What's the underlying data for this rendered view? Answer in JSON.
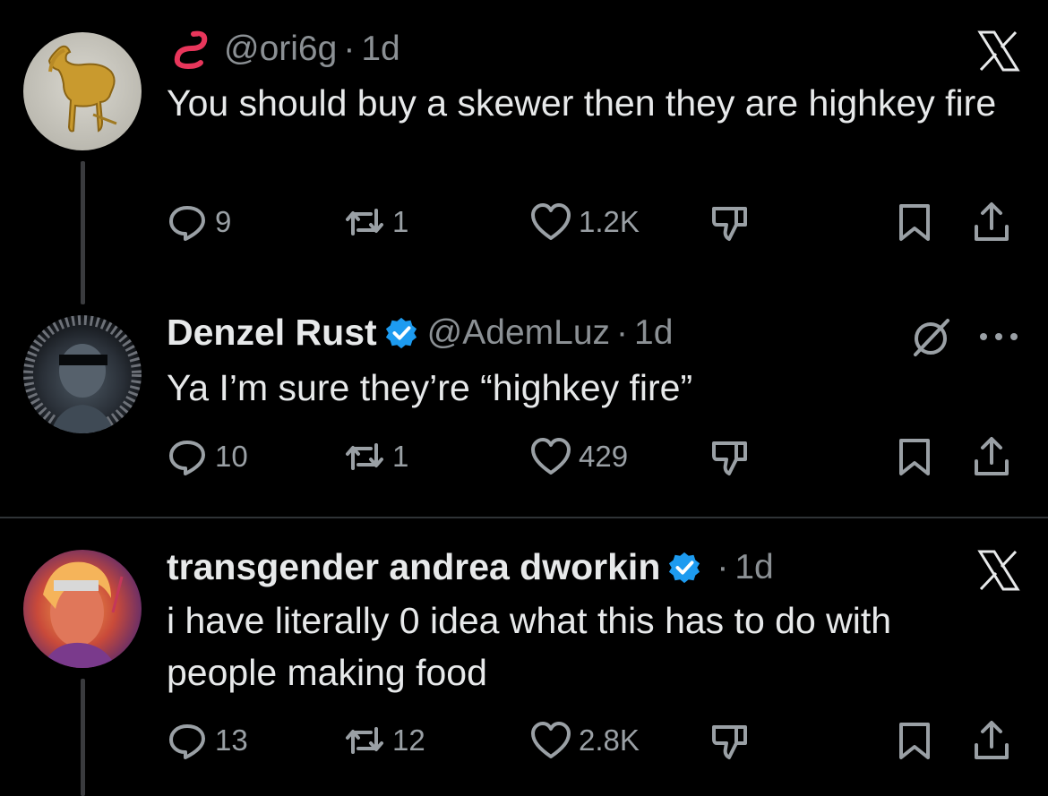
{
  "tweets": [
    {
      "display_name": "",
      "handle": "@ori6g",
      "time": "1d",
      "text": "You should buy a skewer then they are highkey fire",
      "replies": "9",
      "reposts": "1",
      "likes": "1.2K",
      "corner_icon": "x-logo-icon",
      "verified": false
    },
    {
      "display_name": "Denzel Rust",
      "handle": "@AdemLuz",
      "time": "1d",
      "text": "Ya I’m sure they’re “highkey fire”",
      "replies": "10",
      "reposts": "1",
      "likes": "429",
      "corner_icon": "slashed-circle-icon",
      "verified": true
    },
    {
      "display_name": "transgender andrea dworkin",
      "handle": "",
      "time": "1d",
      "text": "i have literally 0 idea what this has to do with people making food",
      "replies": "13",
      "reposts": "12",
      "likes": "2.8K",
      "corner_icon": "x-logo-icon",
      "verified": true
    }
  ],
  "colors": {
    "background": "#000000",
    "text": "#e7e9ea",
    "muted": "#8b9094",
    "verified": "#1d9bf0",
    "name_emoji": "#e8365b"
  },
  "icons": [
    "worm-emoji-icon",
    "verified-badge-icon",
    "reply-icon",
    "repost-icon",
    "like-icon",
    "dislike-icon",
    "bookmark-icon",
    "share-icon",
    "more-icon"
  ]
}
